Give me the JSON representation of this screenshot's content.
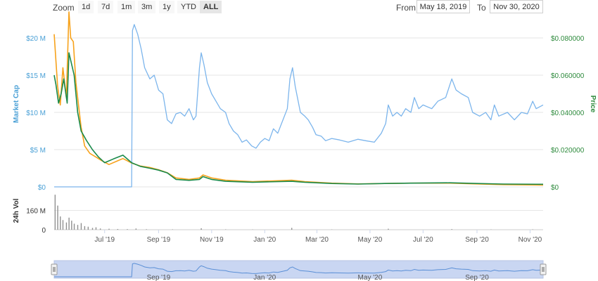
{
  "toolbar": {
    "zoom_label": "Zoom",
    "zoom_buttons": [
      "1d",
      "7d",
      "1m",
      "3m",
      "1y",
      "YTD",
      "ALL"
    ],
    "active_zoom": "ALL",
    "from_label": "From",
    "from_value": "May 18, 2019",
    "to_label": "To",
    "to_value": "Nov 30, 2020"
  },
  "colors": {
    "market_cap": "#7cb5ec",
    "price": "#1a8a4a",
    "volume_bar": "#909090",
    "orange_series": "#f7a21b",
    "left_axis_text": "#4aa0d6",
    "right_axis_text": "#2d8a3c",
    "navigator_fill": "#c9d6f2"
  },
  "chart_data": {
    "type": "line",
    "x_range": [
      "2019-05-18",
      "2020-11-30"
    ],
    "x_ticks": [
      "Jul '19",
      "Sep '19",
      "Nov '19",
      "Jan '20",
      "Mar '20",
      "May '20",
      "Jul '20",
      "Sep '20",
      "Nov '20"
    ],
    "left_axis": {
      "label": "Market Cap",
      "ticks": [
        "$0",
        "$5 M",
        "$10 M",
        "$15 M",
        "$20 M"
      ],
      "ylim": [
        0,
        20000000
      ]
    },
    "right_axis": {
      "label": "Price",
      "ticks": [
        "$0",
        "$0.020000",
        "$0.040000",
        "$0.060000",
        "$0.080000"
      ],
      "ylim": [
        0,
        0.08
      ]
    },
    "volume_axis": {
      "label": "24h Vol",
      "ticks": [
        "0",
        "160 M"
      ],
      "ylim": [
        0,
        320000000
      ]
    },
    "navigator_ticks": [
      "Sep '19",
      "Jan '20",
      "May '20",
      "Sep '20"
    ],
    "series": [
      {
        "key": "market_cap",
        "axis": "left",
        "points": [
          [
            "2019-05-18",
            0
          ],
          [
            "2019-08-15",
            0
          ],
          [
            "2019-08-16",
            21000000
          ],
          [
            "2019-08-18",
            21800000
          ],
          [
            "2019-08-22",
            20500000
          ],
          [
            "2019-08-26",
            18500000
          ],
          [
            "2019-08-30",
            16000000
          ],
          [
            "2019-09-05",
            14500000
          ],
          [
            "2019-09-10",
            15000000
          ],
          [
            "2019-09-15",
            13000000
          ],
          [
            "2019-09-20",
            12500000
          ],
          [
            "2019-09-25",
            9000000
          ],
          [
            "2019-09-30",
            8500000
          ],
          [
            "2019-10-05",
            9800000
          ],
          [
            "2019-10-10",
            10000000
          ],
          [
            "2019-10-15",
            9500000
          ],
          [
            "2019-10-20",
            10500000
          ],
          [
            "2019-10-25",
            9000000
          ],
          [
            "2019-10-28",
            9500000
          ],
          [
            "2019-11-01",
            16000000
          ],
          [
            "2019-11-03",
            18000000
          ],
          [
            "2019-11-06",
            16500000
          ],
          [
            "2019-11-10",
            14000000
          ],
          [
            "2019-11-15",
            12500000
          ],
          [
            "2019-11-20",
            11500000
          ],
          [
            "2019-11-25",
            10500000
          ],
          [
            "2019-12-01",
            10000000
          ],
          [
            "2019-12-05",
            8500000
          ],
          [
            "2019-12-10",
            7500000
          ],
          [
            "2019-12-15",
            7000000
          ],
          [
            "2019-12-20",
            6000000
          ],
          [
            "2019-12-25",
            6300000
          ],
          [
            "2019-12-31",
            5500000
          ],
          [
            "2020-01-05",
            5200000
          ],
          [
            "2020-01-10",
            6000000
          ],
          [
            "2020-01-15",
            6500000
          ],
          [
            "2020-01-20",
            6200000
          ],
          [
            "2020-01-25",
            7800000
          ],
          [
            "2020-01-30",
            7200000
          ],
          [
            "2020-02-05",
            9000000
          ],
          [
            "2020-02-10",
            10500000
          ],
          [
            "2020-02-13",
            14500000
          ],
          [
            "2020-02-16",
            16000000
          ],
          [
            "2020-02-19",
            13500000
          ],
          [
            "2020-02-25",
            10000000
          ],
          [
            "2020-03-01",
            9500000
          ],
          [
            "2020-03-05",
            9000000
          ],
          [
            "2020-03-10",
            8000000
          ],
          [
            "2020-03-14",
            7000000
          ],
          [
            "2020-03-20",
            6800000
          ],
          [
            "2020-03-25",
            6200000
          ],
          [
            "2020-04-01",
            6500000
          ],
          [
            "2020-04-10",
            6300000
          ],
          [
            "2020-04-20",
            6000000
          ],
          [
            "2020-05-01",
            6400000
          ],
          [
            "2020-05-10",
            6200000
          ],
          [
            "2020-05-20",
            6000000
          ],
          [
            "2020-05-28",
            7200000
          ],
          [
            "2020-06-02",
            8500000
          ],
          [
            "2020-06-05",
            11000000
          ],
          [
            "2020-06-10",
            9500000
          ],
          [
            "2020-06-15",
            10000000
          ],
          [
            "2020-06-20",
            9500000
          ],
          [
            "2020-06-25",
            10500000
          ],
          [
            "2020-07-01",
            10000000
          ],
          [
            "2020-07-05",
            12000000
          ],
          [
            "2020-07-10",
            10500000
          ],
          [
            "2020-07-15",
            11000000
          ],
          [
            "2020-07-25",
            10500000
          ],
          [
            "2020-08-01",
            11500000
          ],
          [
            "2020-08-10",
            12000000
          ],
          [
            "2020-08-17",
            14500000
          ],
          [
            "2020-08-22",
            13000000
          ],
          [
            "2020-08-28",
            12500000
          ],
          [
            "2020-09-05",
            12000000
          ],
          [
            "2020-09-10",
            10000000
          ],
          [
            "2020-09-18",
            9500000
          ],
          [
            "2020-09-25",
            10000000
          ],
          [
            "2020-10-01",
            9000000
          ],
          [
            "2020-10-05",
            11000000
          ],
          [
            "2020-10-10",
            9500000
          ],
          [
            "2020-10-20",
            10000000
          ],
          [
            "2020-10-28",
            9000000
          ],
          [
            "2020-11-05",
            10000000
          ],
          [
            "2020-11-12",
            9800000
          ],
          [
            "2020-11-18",
            11500000
          ],
          [
            "2020-11-22",
            10500000
          ],
          [
            "2020-11-30",
            11000000
          ]
        ]
      },
      {
        "key": "orange_series",
        "axis": "left",
        "points": [
          [
            "2019-05-18",
            20500000
          ],
          [
            "2019-05-22",
            13500000
          ],
          [
            "2019-05-25",
            11000000
          ],
          [
            "2019-05-28",
            16000000
          ],
          [
            "2019-06-01",
            12000000
          ],
          [
            "2019-06-04",
            23500000
          ],
          [
            "2019-06-06",
            20000000
          ],
          [
            "2019-06-09",
            19500000
          ],
          [
            "2019-06-12",
            14000000
          ],
          [
            "2019-06-15",
            11000000
          ],
          [
            "2019-06-18",
            8000000
          ],
          [
            "2019-06-22",
            5500000
          ],
          [
            "2019-06-28",
            4500000
          ],
          [
            "2019-07-05",
            4000000
          ],
          [
            "2019-07-12",
            3500000
          ],
          [
            "2019-07-20",
            3000000
          ],
          [
            "2019-07-30",
            3500000
          ],
          [
            "2019-08-05",
            3800000
          ],
          [
            "2019-08-15",
            3200000
          ],
          [
            "2019-08-25",
            2800000
          ],
          [
            "2019-09-05",
            2600000
          ],
          [
            "2019-09-15",
            2300000
          ],
          [
            "2019-09-25",
            1900000
          ],
          [
            "2019-10-05",
            1200000
          ],
          [
            "2019-10-20",
            1000000
          ],
          [
            "2019-11-01",
            1200000
          ],
          [
            "2019-11-05",
            1600000
          ],
          [
            "2019-11-15",
            1200000
          ],
          [
            "2019-12-01",
            900000
          ],
          [
            "2020-01-01",
            700000
          ],
          [
            "2020-02-15",
            900000
          ],
          [
            "2020-03-01",
            700000
          ],
          [
            "2020-04-01",
            500000
          ],
          [
            "2020-05-01",
            400000
          ],
          [
            "2020-06-01",
            450000
          ],
          [
            "2020-07-01",
            500000
          ],
          [
            "2020-08-15",
            500000
          ],
          [
            "2020-09-15",
            400000
          ],
          [
            "2020-10-15",
            300000
          ],
          [
            "2020-11-30",
            250000
          ]
        ]
      },
      {
        "key": "price",
        "axis": "right",
        "points": [
          [
            "2019-05-18",
            0.06
          ],
          [
            "2019-05-20",
            0.055
          ],
          [
            "2019-05-23",
            0.045
          ],
          [
            "2019-05-26",
            0.05
          ],
          [
            "2019-05-29",
            0.058
          ],
          [
            "2019-06-02",
            0.045
          ],
          [
            "2019-06-04",
            0.072
          ],
          [
            "2019-06-06",
            0.068
          ],
          [
            "2019-06-10",
            0.06
          ],
          [
            "2019-06-14",
            0.04
          ],
          [
            "2019-06-18",
            0.03
          ],
          [
            "2019-06-24",
            0.025
          ],
          [
            "2019-07-01",
            0.02
          ],
          [
            "2019-07-08",
            0.016
          ],
          [
            "2019-07-15",
            0.013
          ],
          [
            "2019-07-25",
            0.015
          ],
          [
            "2019-08-05",
            0.017
          ],
          [
            "2019-08-15",
            0.013
          ],
          [
            "2019-08-25",
            0.011
          ],
          [
            "2019-09-05",
            0.01
          ],
          [
            "2019-09-15",
            0.009
          ],
          [
            "2019-09-25",
            0.0075
          ],
          [
            "2019-10-05",
            0.004
          ],
          [
            "2019-10-20",
            0.0035
          ],
          [
            "2019-11-01",
            0.004
          ],
          [
            "2019-11-05",
            0.0055
          ],
          [
            "2019-11-15",
            0.004
          ],
          [
            "2019-12-01",
            0.003
          ],
          [
            "2020-01-01",
            0.0025
          ],
          [
            "2020-02-15",
            0.003
          ],
          [
            "2020-03-01",
            0.0025
          ],
          [
            "2020-04-01",
            0.0018
          ],
          [
            "2020-05-01",
            0.0015
          ],
          [
            "2020-06-01",
            0.0018
          ],
          [
            "2020-07-01",
            0.002
          ],
          [
            "2020-08-15",
            0.0022
          ],
          [
            "2020-09-15",
            0.0018
          ],
          [
            "2020-10-15",
            0.0015
          ],
          [
            "2020-11-30",
            0.0014
          ]
        ]
      }
    ],
    "volume": [
      [
        "2019-05-19",
        290000000
      ],
      [
        "2019-05-22",
        200000000
      ],
      [
        "2019-05-25",
        110000000
      ],
      [
        "2019-05-28",
        80000000
      ],
      [
        "2019-06-01",
        60000000
      ],
      [
        "2019-06-04",
        100000000
      ],
      [
        "2019-06-07",
        75000000
      ],
      [
        "2019-06-10",
        50000000
      ],
      [
        "2019-06-14",
        40000000
      ],
      [
        "2019-06-18",
        55000000
      ],
      [
        "2019-06-22",
        30000000
      ],
      [
        "2019-06-26",
        25000000
      ],
      [
        "2019-07-01",
        15000000
      ],
      [
        "2019-07-05",
        20000000
      ],
      [
        "2019-07-10",
        10000000
      ],
      [
        "2019-07-20",
        8000000
      ],
      [
        "2019-07-30",
        6000000
      ],
      [
        "2019-08-10",
        5000000
      ],
      [
        "2019-08-20",
        10000000
      ],
      [
        "2019-09-01",
        4000000
      ],
      [
        "2019-10-01",
        3000000
      ],
      [
        "2019-11-03",
        12000000
      ],
      [
        "2019-12-01",
        3000000
      ],
      [
        "2020-01-01",
        2000000
      ],
      [
        "2020-02-15",
        15000000
      ],
      [
        "2020-04-01",
        2000000
      ],
      [
        "2020-06-05",
        8000000
      ],
      [
        "2020-08-17",
        5000000
      ],
      [
        "2020-10-01",
        2000000
      ],
      [
        "2020-11-18",
        3000000
      ]
    ]
  }
}
